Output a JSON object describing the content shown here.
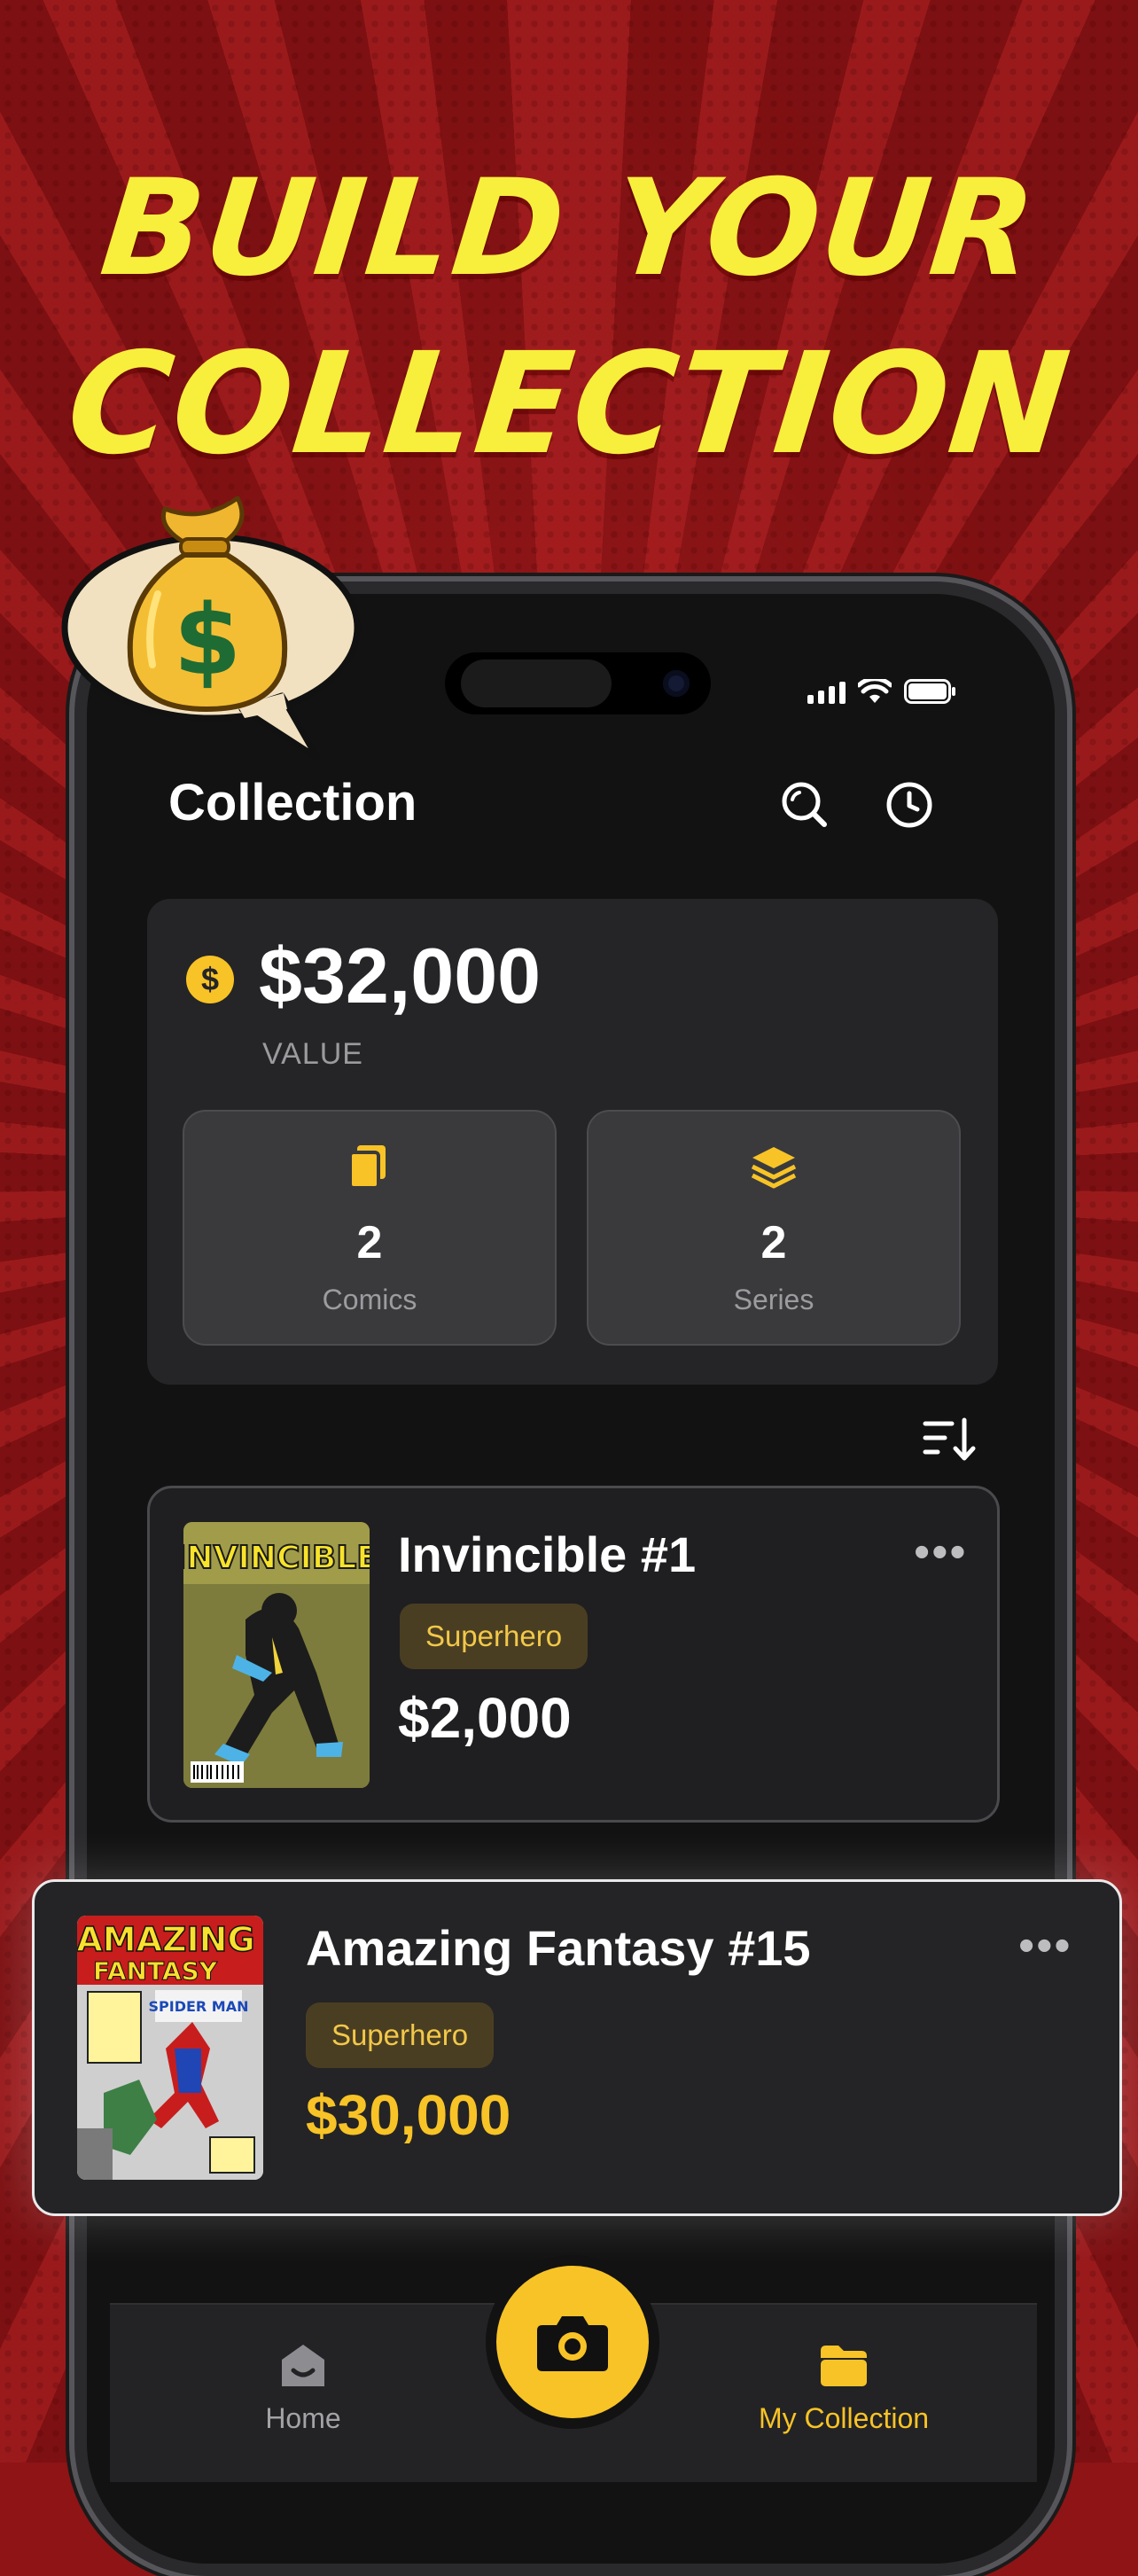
{
  "headline": {
    "line1": "BUILD YOUR",
    "line2": "COLLECTION"
  },
  "colors": {
    "accent": "#F8C326",
    "headline": "#F8EE3C",
    "background": "#8E1416",
    "card": "#252527"
  },
  "status_bar": {
    "icons": [
      "signal-icon",
      "wifi-icon",
      "battery-icon"
    ]
  },
  "header": {
    "title": "Collection",
    "icons": [
      "search-icon",
      "history-icon"
    ]
  },
  "summary": {
    "currency_icon": "dollar-coin-icon",
    "amount": "$32,000",
    "amount_label": "VALUE",
    "stats": [
      {
        "icon": "comics-icon",
        "value": "2",
        "label": "Comics"
      },
      {
        "icon": "series-layers-icon",
        "value": "2",
        "label": "Series"
      }
    ]
  },
  "sort_icon": "sort-icon",
  "items": [
    {
      "title": "Invincible #1",
      "tag": "Superhero",
      "price": "$2,000",
      "cover_text": "INVINCIBLE"
    },
    {
      "title": "Amazing Fantasy #15",
      "tag": "Superhero",
      "price": "$30,000",
      "cover_text1": "AMAZING",
      "cover_text2": "FANTASY",
      "cover_text3": "SPIDER MAN"
    }
  ],
  "nav": {
    "home_label": "Home",
    "collection_label": "My Collection",
    "camera_icon": "camera-icon"
  },
  "decoration": {
    "bubble_icon": "money-bag-icon",
    "bag_symbol": "$"
  }
}
